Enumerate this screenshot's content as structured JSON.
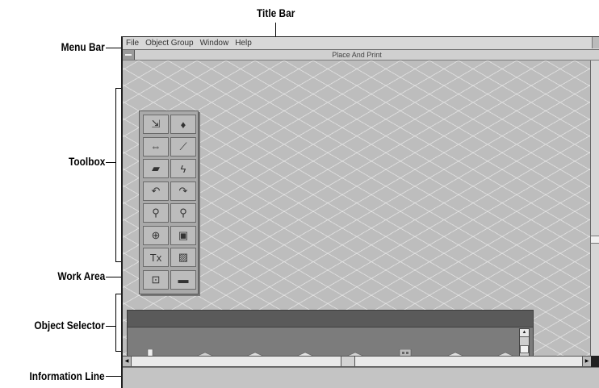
{
  "callouts": {
    "title_bar": "Title Bar",
    "menu_bar": "Menu Bar",
    "toolbox": "Toolbox",
    "work_area": "Work Area",
    "object_selector": "Object Selector",
    "information_line": "Information Line"
  },
  "menubar": {
    "items": [
      "File",
      "Object Group",
      "Window",
      "Help"
    ]
  },
  "document": {
    "title": "Place And Print"
  },
  "toolbox": {
    "tools": [
      {
        "icon": "bulldozer-icon",
        "glyph": "⇲"
      },
      {
        "icon": "water-drop-icon",
        "glyph": "♦"
      },
      {
        "icon": "road-icon",
        "glyph": "⇔"
      },
      {
        "icon": "rail-icon",
        "glyph": "⟋"
      },
      {
        "icon": "terrain-icon",
        "glyph": "▰"
      },
      {
        "icon": "power-line-icon",
        "glyph": "ϟ"
      },
      {
        "icon": "rotate-left-icon",
        "glyph": "↶"
      },
      {
        "icon": "rotate-right-icon",
        "glyph": "↷"
      },
      {
        "icon": "zoom-in-icon",
        "glyph": "⚲"
      },
      {
        "icon": "zoom-out-icon",
        "glyph": "⚲"
      },
      {
        "icon": "globe-icon",
        "glyph": "⊕"
      },
      {
        "icon": "picture-icon",
        "glyph": "▣"
      },
      {
        "icon": "text-tool-icon",
        "glyph": "Tx"
      },
      {
        "icon": "hatch-icon",
        "glyph": "▨"
      },
      {
        "icon": "select-icon",
        "glyph": "⊡"
      },
      {
        "icon": "paint-icon",
        "glyph": "▬"
      }
    ]
  },
  "colors": {
    "work_area_bg": "#bdbdbd",
    "selector_bg": "#7c7c7c",
    "toolbox_bg": "#a9a9a9"
  }
}
